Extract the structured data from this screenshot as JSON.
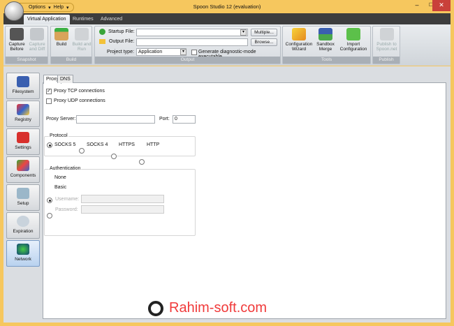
{
  "window": {
    "title": "Spoon Studio 12 (evaluation)",
    "minimize": "–",
    "maximize": "☐",
    "close": "✕"
  },
  "quick_menu": [
    "Options",
    "Help"
  ],
  "ribbon_tabs": [
    "Virtual Application",
    "Runtimes",
    "Advanced"
  ],
  "groups": {
    "snapshot": {
      "label": "Snapshot",
      "capture_before": "Capture Before",
      "capture_and_diff": "Capture and Diff"
    },
    "build": {
      "label": "Build",
      "build": "Build",
      "build_and_run": "Build and Run"
    },
    "output": {
      "label": "Output",
      "startup_file_label": "Startup File:",
      "startup_file": "",
      "output_file_label": "Output File:",
      "output_file": "",
      "multiple": "Multiple...",
      "browse": "Browse...",
      "project_type_label": "Project type:",
      "project_type": "Application",
      "diag_label": "Generate diagnostic-mode executable"
    },
    "tools": {
      "label": "Tools",
      "config_wizard": "Configuration Wizard",
      "sandbox_merge": "Sandbox Merge",
      "import_config": "Import Configuration"
    },
    "publish": {
      "label": "Publish",
      "publish_spoon": "Publish to Spoon.net"
    }
  },
  "sidebar": [
    "Filesystem",
    "Registry",
    "Settings",
    "Components",
    "Setup",
    "Expiration",
    "Network"
  ],
  "panel_tabs": [
    "Proxy",
    "DNS"
  ],
  "proxy": {
    "tcp": "Proxy TCP connections",
    "udp": "Proxy UDP connections",
    "server_label": "Proxy Server:",
    "server": "",
    "port_label": "Port:",
    "port": "0",
    "protocol_label": "Protocol",
    "protocols": [
      "SOCKS 5",
      "SOCKS 4",
      "HTTPS",
      "HTTP"
    ],
    "auth_label": "Authentication",
    "auth_none": "None",
    "auth_basic": "Basic",
    "username_label": "Username:",
    "password_label": "Password:"
  },
  "watermark": "Rahim-soft.com"
}
